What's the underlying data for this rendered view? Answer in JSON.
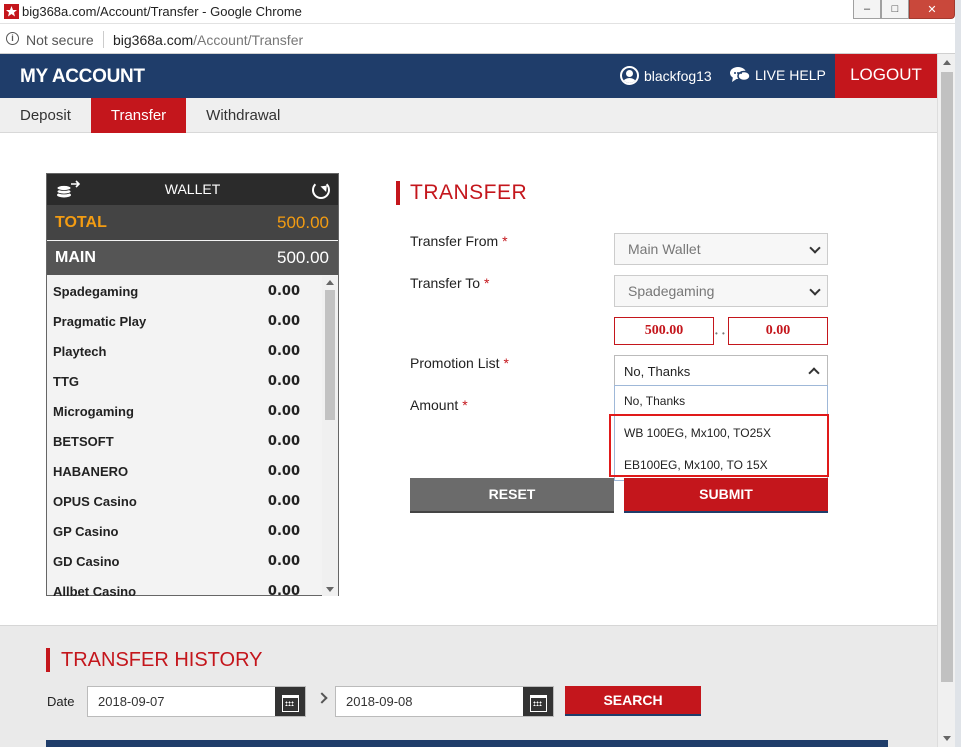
{
  "window": {
    "title": "big368a.com/Account/Transfer - Google Chrome",
    "minimize": "–",
    "maximize": "□",
    "close": "✕"
  },
  "address_bar": {
    "security": "Not secure",
    "domain": "big368a.com",
    "path": "/Account/Transfer"
  },
  "header": {
    "brand": "MY ACCOUNT",
    "username": "blackfog13",
    "live_help": "LIVE HELP",
    "logout": "LOGOUT"
  },
  "tabs": [
    {
      "label": "Deposit"
    },
    {
      "label": "Transfer"
    },
    {
      "label": "Withdrawal"
    }
  ],
  "wallet": {
    "title": "WALLET",
    "total_label": "TOTAL",
    "total_amount": "500.00",
    "main_label": "MAIN",
    "main_amount": "500.00",
    "items": [
      {
        "name": "Spadegaming",
        "value": "0.00"
      },
      {
        "name": "Pragmatic Play",
        "value": "0.00"
      },
      {
        "name": "Playtech",
        "value": "0.00"
      },
      {
        "name": "TTG",
        "value": "0.00"
      },
      {
        "name": "Microgaming",
        "value": "0.00"
      },
      {
        "name": "BETSOFT",
        "value": "0.00"
      },
      {
        "name": "HABANERO",
        "value": "0.00"
      },
      {
        "name": "OPUS Casino",
        "value": "0.00"
      },
      {
        "name": "GP Casino",
        "value": "0.00"
      },
      {
        "name": "GD Casino",
        "value": "0.00"
      },
      {
        "name": "Allbet Casino",
        "value": "0.00"
      }
    ]
  },
  "transfer": {
    "title": "TRANSFER",
    "required_mark": "*",
    "from_label": "Transfer From",
    "from_value": "Main Wallet",
    "to_label": "Transfer To",
    "to_value": "Spadegaming",
    "from_balance": "500.00",
    "to_balance": "0.00",
    "promo_label": "Promotion List",
    "promo_selected": "No, Thanks",
    "promo_options": [
      {
        "label": "No, Thanks"
      },
      {
        "label": "WB 100EG, Mx100, TO25X"
      },
      {
        "label": "EB100EG, Mx100, TO 15X"
      }
    ],
    "amount_label": "Amount",
    "reset_label": "RESET",
    "submit_label": "SUBMIT"
  },
  "history": {
    "title": "TRANSFER HISTORY",
    "date_label": "Date",
    "date_from": "2018-09-07",
    "date_to": "2018-09-08",
    "search_label": "SEARCH"
  },
  "colors": {
    "header_bg": "#1f3d6a",
    "accent_red": "#c4161c",
    "total_orange": "#f39c12"
  }
}
